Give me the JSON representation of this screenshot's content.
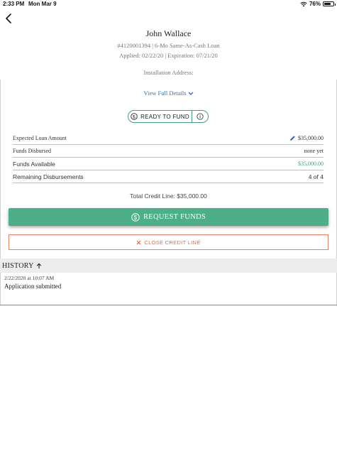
{
  "status_bar": {
    "time": "2:33 PM",
    "date": "Mon Mar 9",
    "battery": "76%",
    "battery_level": 0.76
  },
  "header": {
    "name": "John Wallace",
    "loan_line": "#4120001394 | 6-Mo Same-As-Cash Loan",
    "dates_line": "Applied: 02/22/20 | Expiration: 07/21/20",
    "installation_label": "Installation Address:"
  },
  "details_link": "View Full Details",
  "status": {
    "label": "READY TO FUND",
    "color": "#46a281"
  },
  "rows": [
    {
      "label": "Expected Loan Amount",
      "value": "$35,000.00"
    },
    {
      "label": "Funds Disbursed",
      "value": "none yet"
    },
    {
      "label": "Funds Available",
      "value": "$35,000.00"
    },
    {
      "label": "Remaining Disbursements",
      "value": "4 of 4"
    }
  ],
  "total_credit_line": "Total Credit Line: $35,000.00",
  "request_button": {
    "label": "REQUEST FUNDS",
    "color": "#4daf88"
  },
  "close_button": {
    "label": "CLOSE CREDIT LINE",
    "color": "#e26a45"
  },
  "history": {
    "title": "HISTORY",
    "items": [
      {
        "timestamp": "2/22/2020 at 10:07 AM",
        "event": "Application submitted"
      }
    ]
  },
  "icons": {
    "back": "chevron-left-icon",
    "wifi": "wifi-icon",
    "battery": "battery-icon",
    "expand": "chevron-down-icon",
    "dollar": "dollar-circle-icon",
    "info": "info-icon",
    "edit": "pencil-icon",
    "close": "close-icon",
    "sort": "arrow-up-icon"
  }
}
